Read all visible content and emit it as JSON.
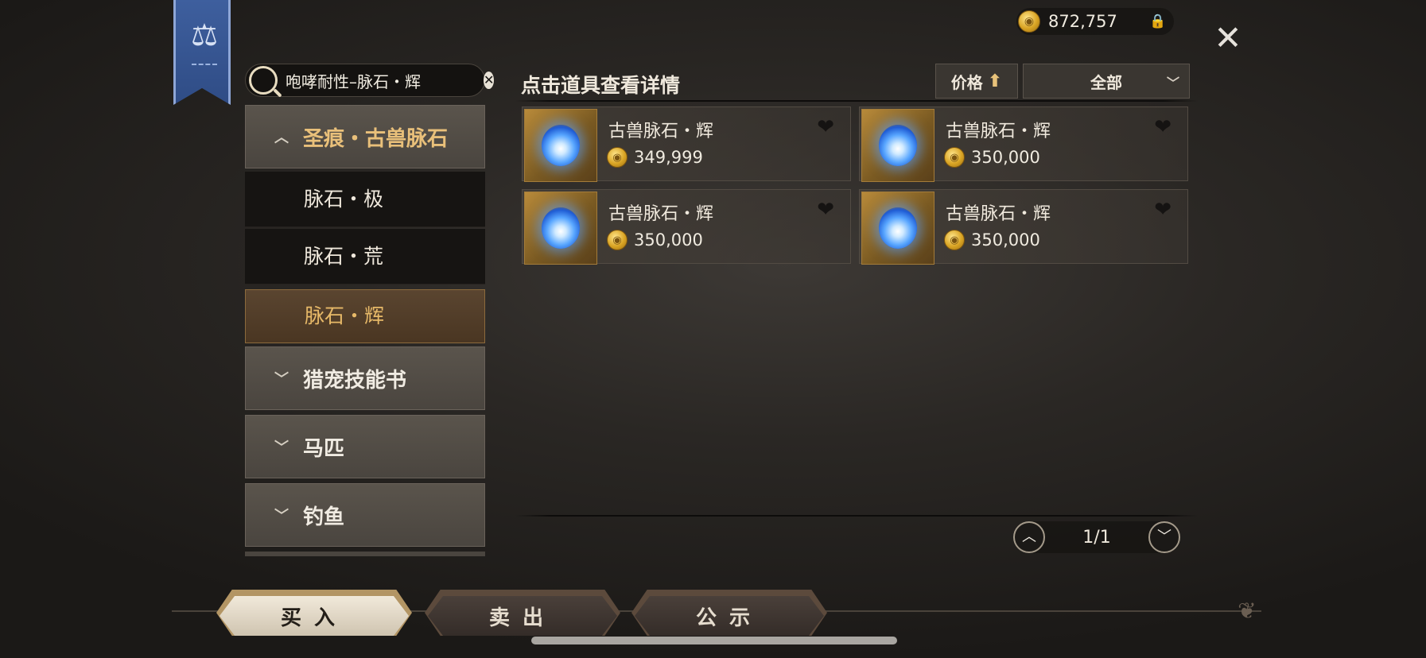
{
  "currency": {
    "amount": "872,757",
    "icon": "gold-coin-icon",
    "lock_icon": "lock-icon"
  },
  "search": {
    "value": "咆哮耐性–脉石・辉"
  },
  "sidebar": {
    "categories": [
      {
        "label": "圣痕・古兽脉石",
        "expanded": true,
        "subitems": [
          {
            "label": "脉石・极"
          },
          {
            "label": "脉石・荒"
          },
          {
            "label": "脉石・辉",
            "selected": true
          }
        ]
      },
      {
        "label": "猎宠技能书",
        "expanded": false
      },
      {
        "label": "马匹",
        "expanded": false
      },
      {
        "label": "钓鱼",
        "expanded": false
      }
    ]
  },
  "header": {
    "hint": "点击道具查看详情",
    "sort_label": "价格",
    "filter_label": "全部"
  },
  "items": [
    {
      "name": "古兽脉石・辉",
      "price": "349,999"
    },
    {
      "name": "古兽脉石・辉",
      "price": "350,000"
    },
    {
      "name": "古兽脉石・辉",
      "price": "350,000"
    },
    {
      "name": "古兽脉石・辉",
      "price": "350,000"
    }
  ],
  "pagination": {
    "label": "1/1"
  },
  "tabs": [
    {
      "label": "买入",
      "active": true
    },
    {
      "label": "卖出",
      "active": false
    },
    {
      "label": "公示",
      "active": false
    }
  ],
  "colors": {
    "accent_gold": "#e7b968",
    "banner_blue": "#3e5f9e",
    "orb_blue": "#58a6ff"
  }
}
